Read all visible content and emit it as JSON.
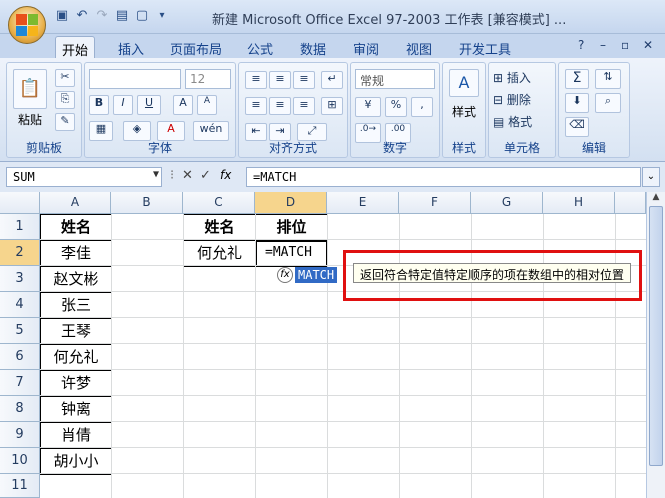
{
  "window": {
    "title": "新建 Microsoft Office Excel 97-2003 工作表 [兼容模式] ..."
  },
  "ribbon": {
    "tabs": [
      "开始",
      "插入",
      "页面布局",
      "公式",
      "数据",
      "审阅",
      "视图",
      "开发工具"
    ],
    "active_tab": "开始",
    "groups": {
      "clipboard": {
        "label": "剪贴板",
        "paste_label": "粘贴"
      },
      "font": {
        "label": "字体",
        "font_name": "",
        "font_size": "12",
        "bold": "B",
        "italic": "I",
        "underline": "U",
        "grow": "A",
        "shrink": "A",
        "phonetic": "wén"
      },
      "alignment": {
        "label": "对齐方式"
      },
      "number": {
        "label": "数字",
        "format": "常规",
        "percent": "%",
        "comma": ","
      },
      "styles": {
        "label": "样式",
        "styles_label": "样式"
      },
      "cells": {
        "label": "单元格",
        "insert": "插入",
        "delete": "删除",
        "format": "格式"
      },
      "editing": {
        "label": "编辑",
        "sum": "Σ"
      }
    }
  },
  "formula_bar": {
    "name_box": "SUM",
    "fx": "fx",
    "formula": "=MATCH"
  },
  "columns": [
    "A",
    "B",
    "C",
    "D",
    "E",
    "F",
    "G",
    "H"
  ],
  "rows": [
    "1",
    "2",
    "3",
    "4",
    "5",
    "6",
    "7",
    "8",
    "9",
    "10",
    "11"
  ],
  "cells": {
    "A1": "姓名",
    "A2": "李佳",
    "A3": "赵文彬",
    "A4": "张三",
    "A5": "王琴",
    "A6": "何允礼",
    "A7": "许梦",
    "A8": "钟离",
    "A9": "肖倩",
    "A10": "胡小小",
    "C1": "姓名",
    "D1": "排位",
    "C2": "何允礼",
    "D2": "=MATCH"
  },
  "autocomplete": {
    "icon": "fx",
    "function_name": "MATCH",
    "tooltip": "返回符合特定值特定顺序的项在数组中的相对位置"
  },
  "colors": {
    "highlight_box": "#e01010",
    "selection": "#316ac5"
  }
}
